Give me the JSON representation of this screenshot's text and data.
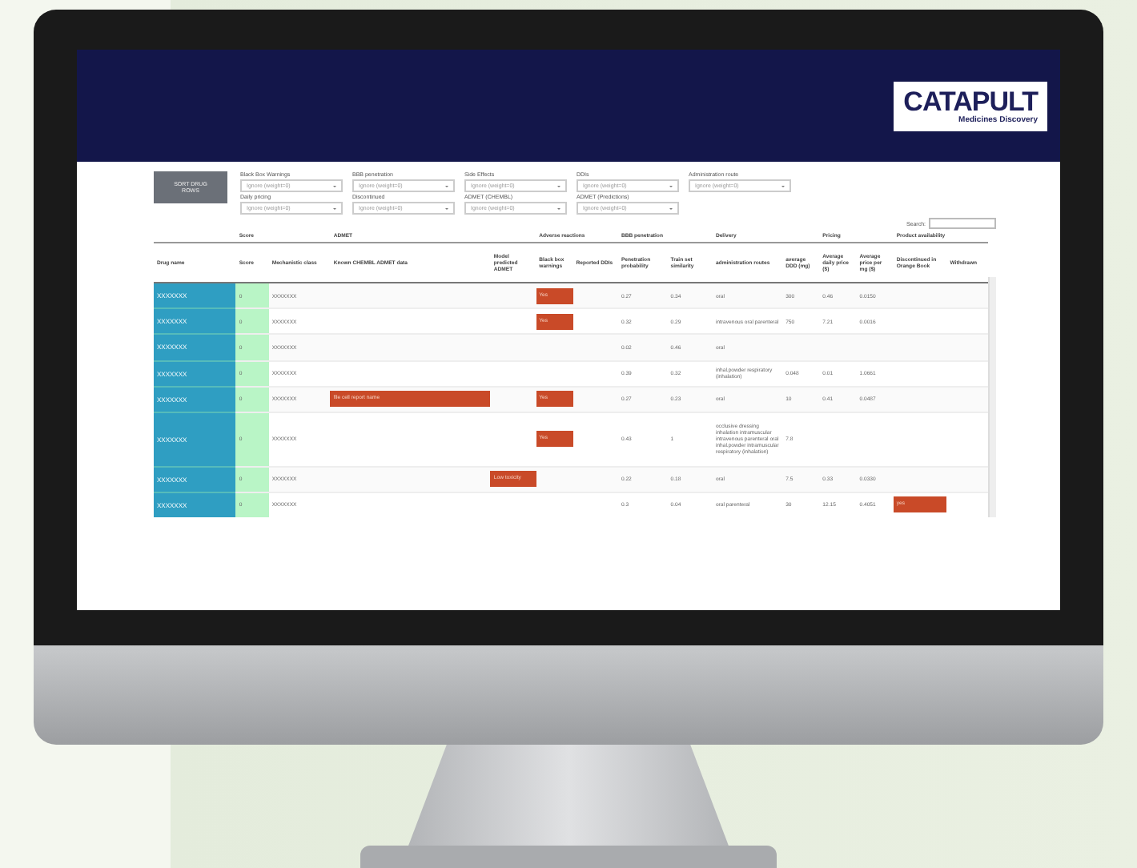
{
  "logo": {
    "name": "CATAPULT",
    "tagline": "Medicines Discovery"
  },
  "sort_button": "SORT DRUG ROWS",
  "filters": [
    {
      "label": "Black Box Warnings",
      "placeholder": "Ignore (weight=0)"
    },
    {
      "label": "BBB penetration",
      "placeholder": "Ignore (weight=0)"
    },
    {
      "label": "Side Effects",
      "placeholder": "Ignore (weight=0)"
    },
    {
      "label": "DDIs",
      "placeholder": "Ignore (weight=0)"
    },
    {
      "label": "Administration route",
      "placeholder": "Ignore (weight=0)"
    },
    {
      "label": "Daily pricing",
      "placeholder": "Ignore (weight=0)"
    },
    {
      "label": "Discontinued",
      "placeholder": "Ignore (weight=0)"
    },
    {
      "label": "ADMET (CHEMBL)",
      "placeholder": "Ignore (weight=0)"
    },
    {
      "label": "ADMET (Predictions)",
      "placeholder": "Ignore (weight=0)"
    }
  ],
  "search": {
    "label": "Search:"
  },
  "table": {
    "groups": [
      {
        "label": "Score"
      },
      {
        "label": "ADMET"
      },
      {
        "label": "Adverse reactions"
      },
      {
        "label": "BBB penetration"
      },
      {
        "label": "Delivery"
      },
      {
        "label": "Pricing"
      },
      {
        "label": "Product availability"
      }
    ],
    "columns": [
      "Drug name",
      "Score",
      "Mechanistic class",
      "Known CHEMBL ADMET data",
      "Model predicted ADMET",
      "Black box warnings",
      "Reported DDIs",
      "Penetration probability",
      "Train set similarity",
      "administration routes",
      "average DDD (mg)",
      "Average daily price ($)",
      "Average price per mg ($)",
      "Discontinued in Orange Book",
      "Withdrawn"
    ],
    "rows": [
      {
        "cells": [
          "XXXXXXX",
          "0",
          "XXXXXXX",
          "",
          "",
          "Yes",
          "",
          "0.27",
          "0.34",
          "oral",
          "300",
          "0.46",
          "0.0150",
          "",
          ""
        ]
      },
      {
        "cells": [
          "XXXXXXX",
          "0",
          "XXXXXXX",
          "",
          "",
          "Yes",
          "",
          "0.32",
          "0.29",
          "intravenous oral parenteral",
          "750",
          "7.21",
          "0.0016",
          "",
          ""
        ]
      },
      {
        "cells": [
          "XXXXXXX",
          "0",
          "XXXXXXX",
          "",
          "",
          "",
          "",
          "0.02",
          "0.46",
          "oral",
          "",
          "",
          "",
          "",
          ""
        ]
      },
      {
        "cells": [
          "XXXXXXX",
          "0",
          "XXXXXXX",
          "",
          "",
          "",
          "",
          "0.39",
          "0.32",
          "inhal.powder respiratory (inhalation)",
          "0.048",
          "0.01",
          "1.0661",
          "",
          ""
        ]
      },
      {
        "cells": [
          "XXXXXXX",
          "0",
          "XXXXXXX",
          "file cell report name",
          "",
          "Yes",
          "",
          "0.27",
          "0.23",
          "oral",
          "10",
          "0.41",
          "0.0487",
          "",
          ""
        ]
      },
      {
        "cells": [
          "XXXXXXX",
          "0",
          "XXXXXXX",
          "",
          "",
          "Yes",
          "",
          "0.43",
          "1",
          "occlusive dressing inhalation intramuscular intravenous parenteral oral inhal.powder intramuscular respiratory (inhalation)",
          "7.8",
          "",
          "",
          "",
          ""
        ]
      },
      {
        "cells": [
          "XXXXXXX",
          "0",
          "XXXXXXX",
          "",
          "Low toxicity",
          "",
          "",
          "0.22",
          "0.18",
          "oral",
          "7.5",
          "0.33",
          "0.0330",
          "",
          ""
        ]
      },
      {
        "cells": [
          "XXXXXXX",
          "0",
          "XXXXXXX",
          "",
          "",
          "",
          "",
          "0.3",
          "0.04",
          "oral parenteral",
          "30",
          "12.15",
          "0.4051",
          "yes",
          ""
        ]
      }
    ]
  }
}
